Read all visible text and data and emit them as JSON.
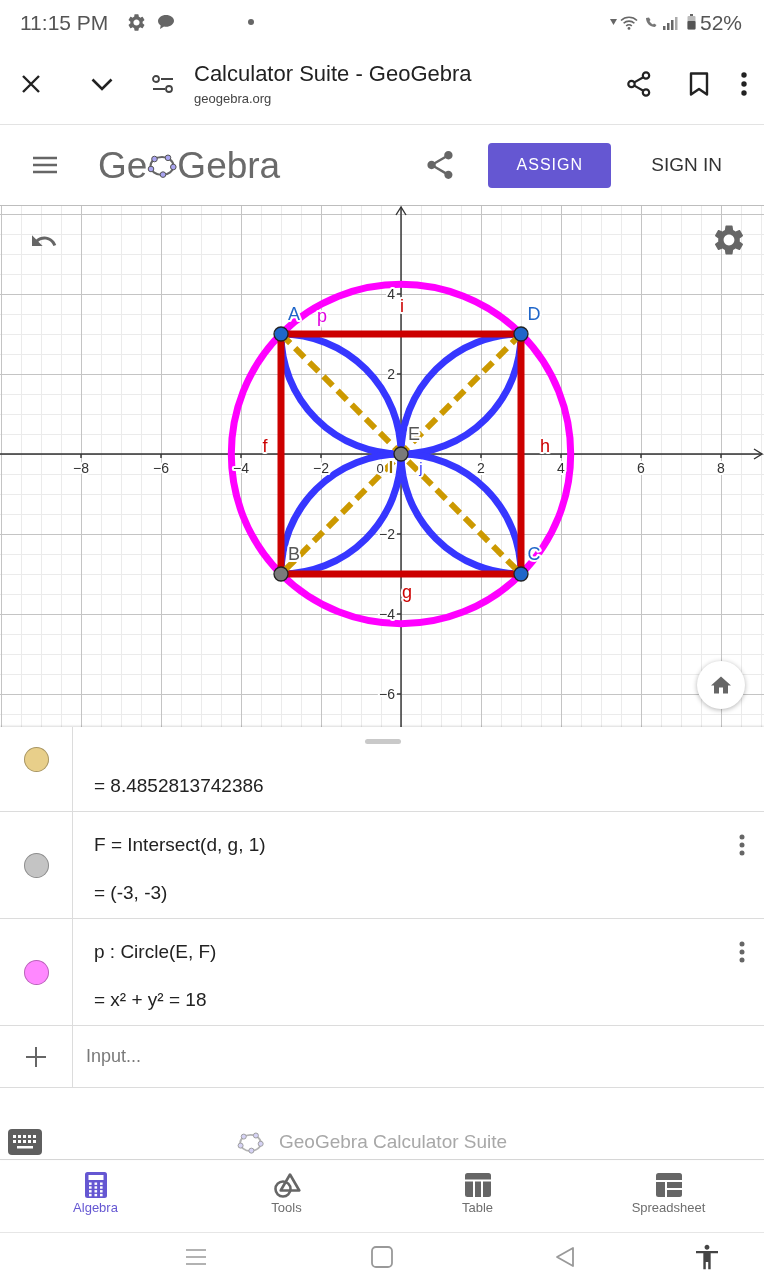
{
  "status_bar": {
    "time": "11:15 PM",
    "battery": "52%"
  },
  "browser": {
    "title": "Calculator Suite - GeoGebra",
    "url": "geogebra.org"
  },
  "header": {
    "logo_start": "Ge",
    "logo_end": "Gebra",
    "assign": "ASSIGN",
    "sign_in": "SIGN IN"
  },
  "graph": {
    "x_ticks": [
      "−8",
      "−6",
      "−4",
      "−2",
      "2",
      "4",
      "6",
      "8"
    ],
    "origin": "0",
    "y_ticks": [
      "4",
      "2",
      "−2",
      "−4",
      "−6"
    ],
    "points": [
      {
        "label": "A",
        "kind": "free"
      },
      {
        "label": "D",
        "kind": "free"
      },
      {
        "label": "C",
        "kind": "free"
      },
      {
        "label": "B",
        "kind": "intersection"
      },
      {
        "label": "E",
        "kind": "intersection"
      }
    ],
    "object_labels": [
      {
        "text": "p",
        "kind": "circle"
      },
      {
        "text": "i",
        "kind": "segment"
      },
      {
        "text": "f",
        "kind": "segment"
      },
      {
        "text": "h",
        "kind": "segment"
      },
      {
        "text": "g",
        "kind": "segment"
      },
      {
        "text": "l",
        "kind": "diagonal"
      },
      {
        "text": "j",
        "kind": "arc"
      }
    ]
  },
  "algebra": {
    "rows": [
      {
        "color": "#e8cf8a",
        "value": "= 8.4852813742386",
        "menu": false
      },
      {
        "color": "#c4c4c4",
        "definition": "F = Intersect(d, g, 1)",
        "value": "= (-3, -3)",
        "menu": true
      },
      {
        "color": "#ff88ff",
        "definition": "p : Circle(E, F)",
        "value": "= x² + y² = 18",
        "menu": true
      }
    ],
    "input": {
      "placeholder": "Input..."
    },
    "brand": "GeoGebra Calculator Suite"
  },
  "bottom_nav": [
    {
      "label": "Algebra",
      "selected": true
    },
    {
      "label": "Tools",
      "selected": false
    },
    {
      "label": "Table",
      "selected": false
    },
    {
      "label": "Spreadsheet",
      "selected": false
    }
  ]
}
